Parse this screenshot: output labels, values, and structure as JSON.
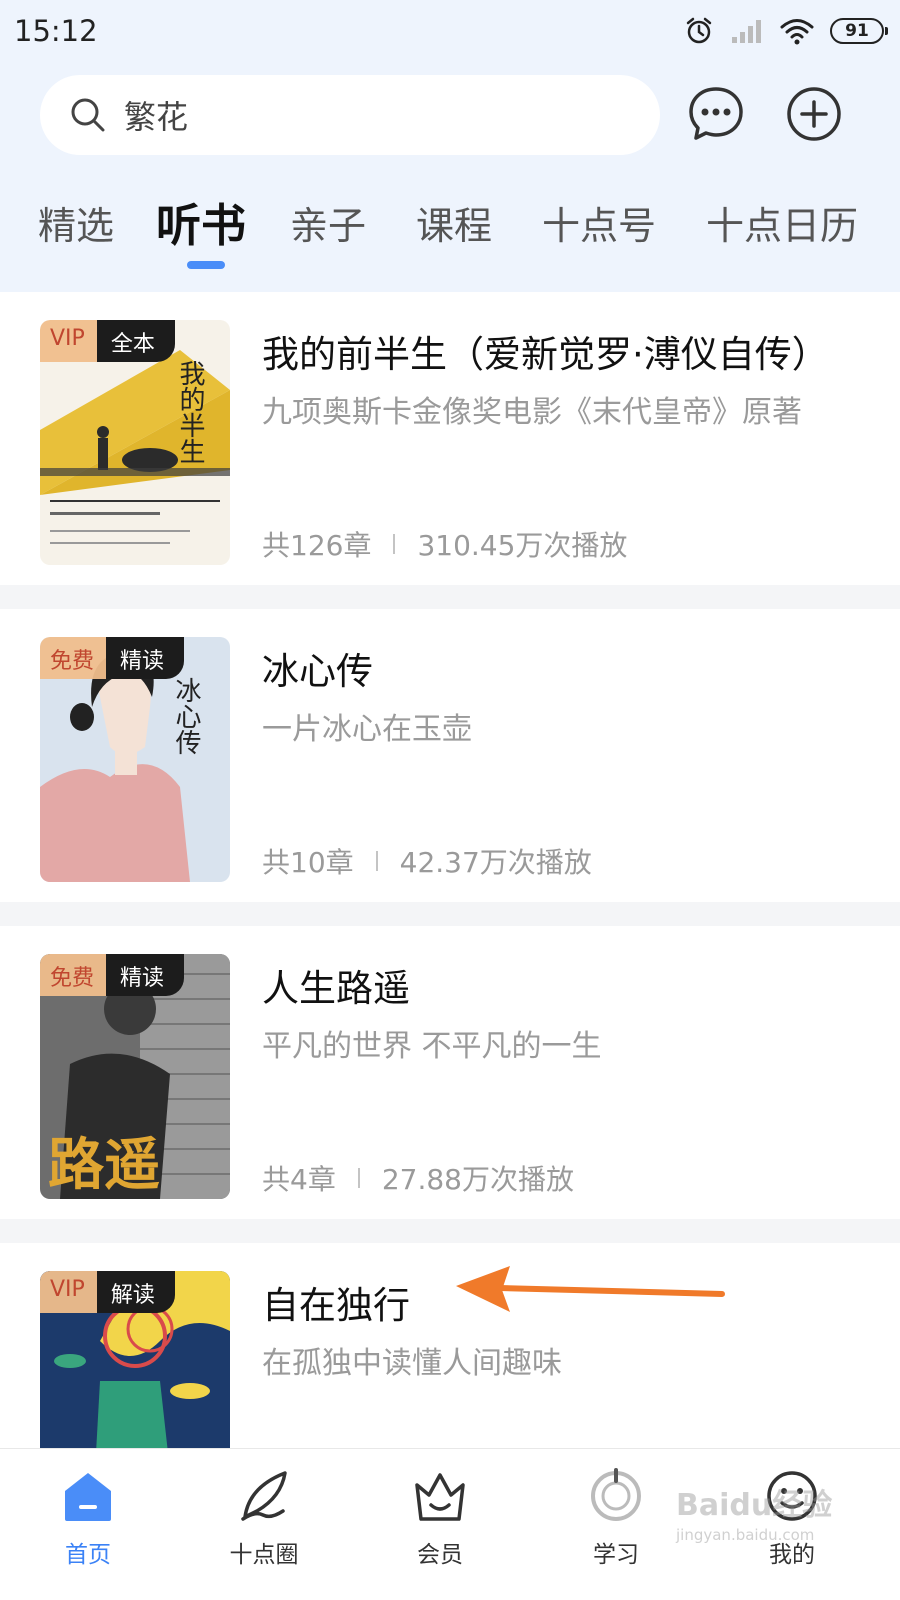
{
  "status_bar": {
    "time": "15:12",
    "battery": "91",
    "icons": [
      "alarm-icon",
      "signal-icon",
      "wifi-icon",
      "battery-icon"
    ]
  },
  "search": {
    "value": "繁花"
  },
  "header_actions": [
    "message-icon",
    "add-icon"
  ],
  "tabs": [
    {
      "label": "精选"
    },
    {
      "label": "听书",
      "active": true
    },
    {
      "label": "亲子"
    },
    {
      "label": "课程"
    },
    {
      "label": "十点号"
    },
    {
      "label": "十点日历"
    }
  ],
  "books": [
    {
      "badge1": "VIP",
      "badge2": "全本",
      "title": "我的前半生（爱新觉罗·溥仪自传）",
      "subtitle": "九项奥斯卡金像奖电影《末代皇帝》原著",
      "chapters": "共126章",
      "plays": "310.45万次播放",
      "cover_text": "我的半生"
    },
    {
      "badge1": "免费",
      "badge2": "精读",
      "title": "冰心传",
      "subtitle": "一片冰心在玉壶",
      "chapters": "共10章",
      "plays": "42.37万次播放",
      "cover_text": "冰心传"
    },
    {
      "badge1": "免费",
      "badge2": "精读",
      "title": "人生路遥",
      "subtitle": "平凡的世界 不平凡的一生",
      "chapters": "共4章",
      "plays": "27.88万次播放",
      "cover_text": "路遥"
    },
    {
      "badge1": "VIP",
      "badge2": "解读",
      "title": "自在独行",
      "subtitle": "在孤独中读懂人间趣味",
      "chapters": "",
      "plays": ""
    }
  ],
  "bottom_nav": [
    {
      "label": "首页",
      "icon": "home-icon",
      "active": true
    },
    {
      "label": "十点圈",
      "icon": "feather-icon"
    },
    {
      "label": "会员",
      "icon": "crown-icon"
    },
    {
      "label": "学习",
      "icon": "study-icon"
    },
    {
      "label": "我的",
      "icon": "profile-icon"
    }
  ],
  "watermark": {
    "line1": "Baidu经验",
    "line2": "jingyan.baidu.com"
  },
  "colors": {
    "accent": "#3b82f6",
    "header_bg": "#eef4fd",
    "arrow": "#f07a2a"
  }
}
